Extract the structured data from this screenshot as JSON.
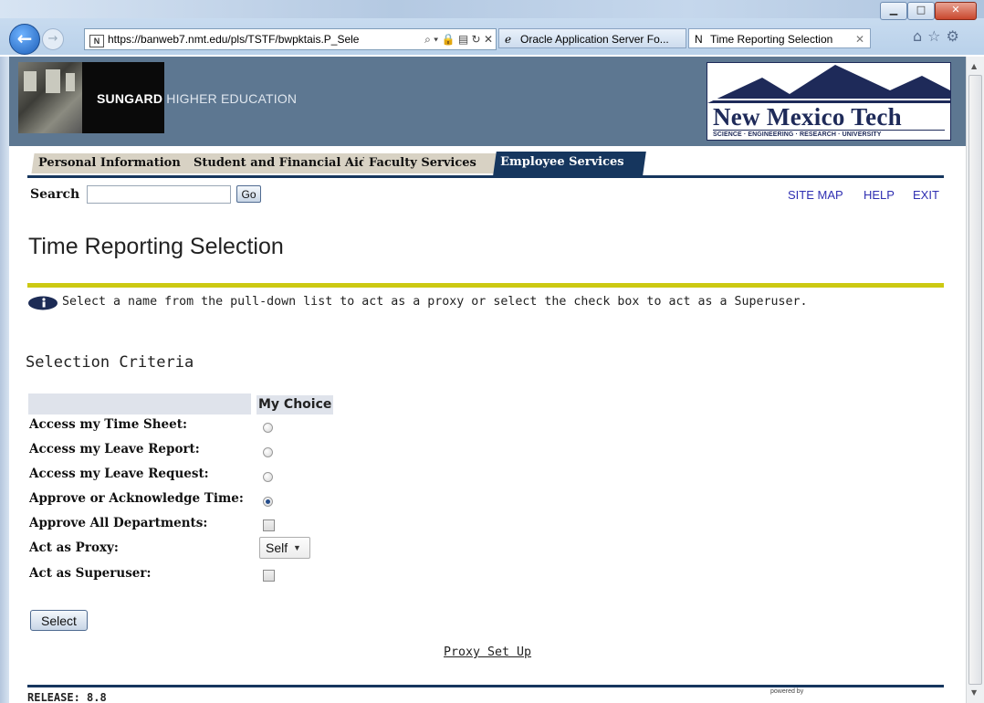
{
  "browser": {
    "address_url": "https://banweb7.nmt.edu/pls/TSTF/bwpktais.P_Sele",
    "address_domain": "banweb7.nmt.edu",
    "tabs": [
      {
        "label": "Oracle Application Server Fo..."
      },
      {
        "label": "Time Reporting Selection"
      }
    ],
    "favicon_text": "N"
  },
  "header": {
    "brand_bold": "SUNGARD",
    "brand_rest": "HIGHER EDUCATION",
    "logo_name": "New Mexico Tech",
    "logo_tagline": "SCIENCE · ENGINEERING · RESEARCH · UNIVERSITY"
  },
  "tabs": [
    {
      "label": "Personal Information"
    },
    {
      "label": "Student and Financial Aid"
    },
    {
      "label": "Faculty Services"
    },
    {
      "label": "Employee Services",
      "active": true
    }
  ],
  "search": {
    "label": "Search",
    "value": "",
    "go_label": "Go"
  },
  "top_links": {
    "site_map": "SITE MAP",
    "help": "HELP",
    "exit": "EXIT"
  },
  "page_title": "Time Reporting Selection",
  "info_text": "Select a name from the pull-down list to act as a proxy or select the check box to act as a Superuser.",
  "section_title": "Selection Criteria",
  "form": {
    "column_header": "My Choice",
    "rows": [
      {
        "label": "Access my Time Sheet:",
        "control": "radio",
        "checked": false
      },
      {
        "label": "Access my Leave Report:",
        "control": "radio",
        "checked": false
      },
      {
        "label": "Access my Leave Request:",
        "control": "radio",
        "checked": false
      },
      {
        "label": "Approve or Acknowledge Time:",
        "control": "radio",
        "checked": true
      },
      {
        "label": "Approve All Departments:",
        "control": "checkbox",
        "checked": false
      },
      {
        "label": "Act as Proxy:",
        "control": "select",
        "value": "Self"
      },
      {
        "label": "Act as Superuser:",
        "control": "checkbox",
        "checked": false
      }
    ],
    "submit_label": "Select",
    "proxy_link": "Proxy Set Up"
  },
  "footer": {
    "release": "RELEASE: 8.8",
    "powered": "powered by"
  },
  "colors": {
    "tab_active": "#16365e",
    "accent_line": "#ccc912",
    "header_bg": "#5d7791",
    "link": "#2f2fb2"
  },
  "icons": [
    "back-arrow-icon",
    "forward-arrow-icon",
    "search-icon",
    "lock-icon",
    "refresh-icon",
    "home-icon",
    "star-icon",
    "gear-icon",
    "info-icon"
  ]
}
